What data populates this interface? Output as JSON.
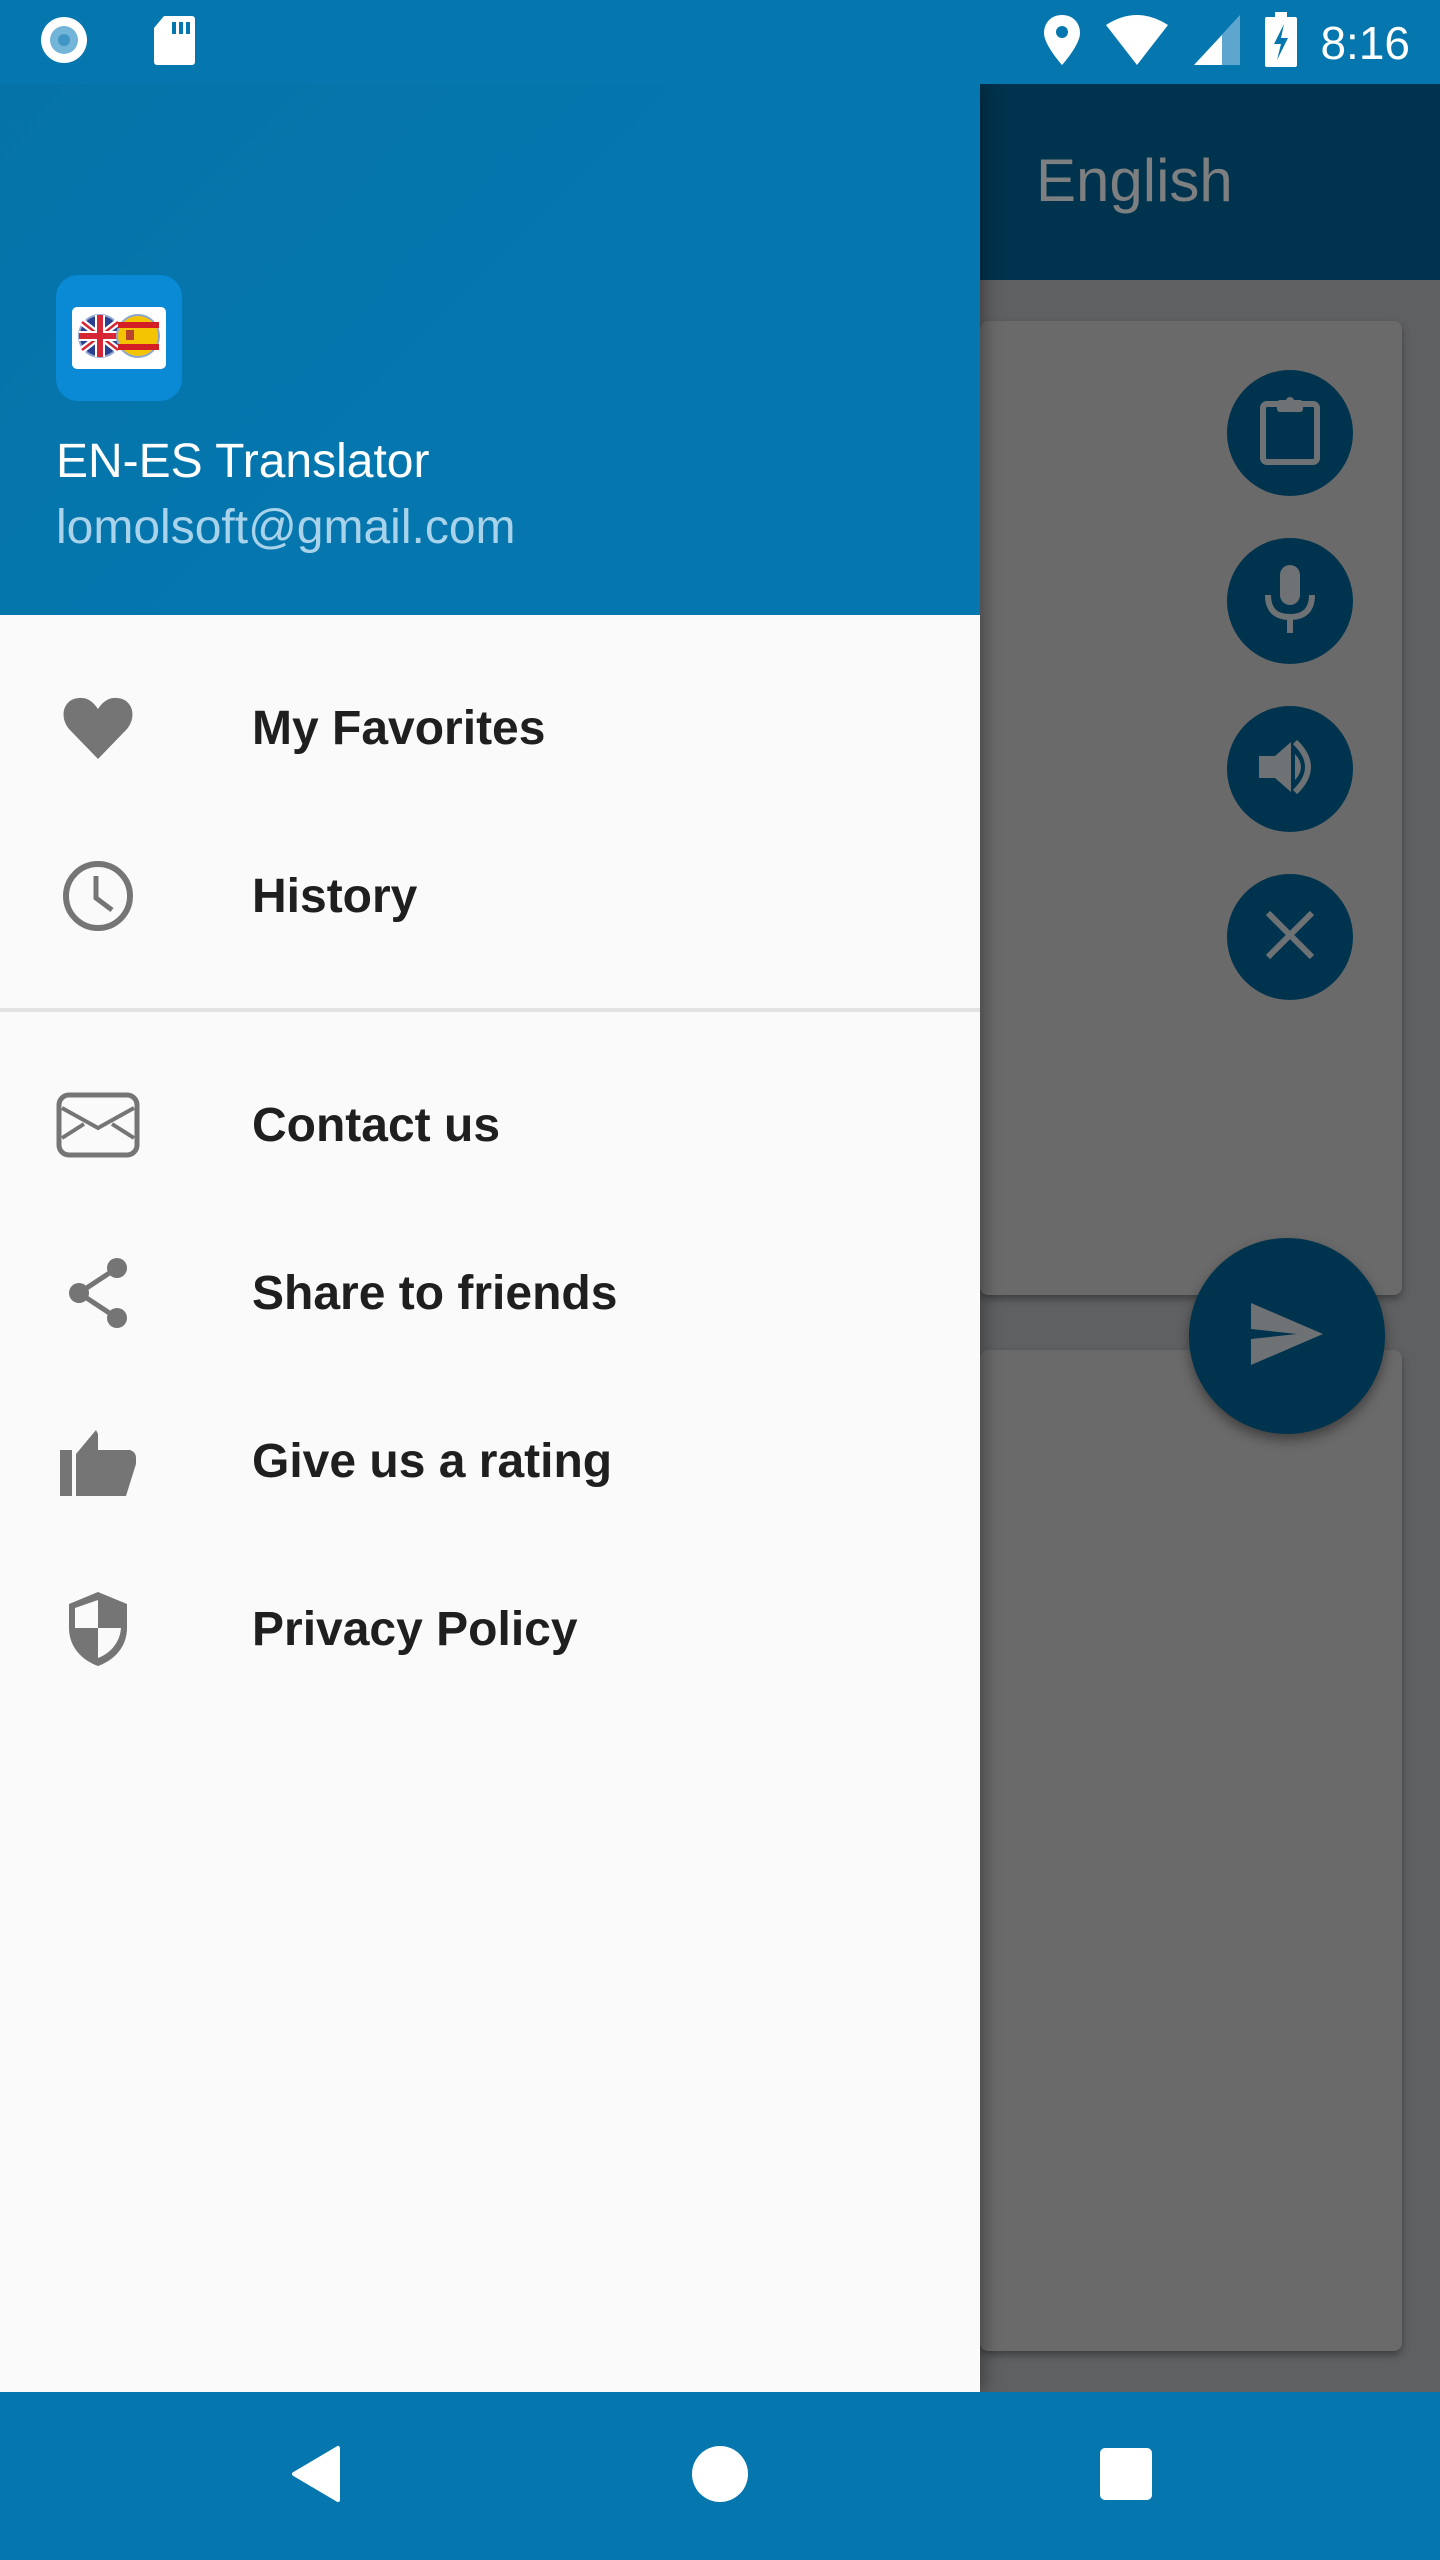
{
  "status_bar": {
    "time": "8:16",
    "left_icons": [
      "circle-notification-icon",
      "sd-card-icon"
    ],
    "right_icons": [
      "location-icon",
      "wifi-icon",
      "signal-icon",
      "battery-charging-icon"
    ]
  },
  "background_app": {
    "app_bar_title": "English",
    "action_buttons": [
      "clipboard-icon",
      "microphone-icon",
      "speaker-icon",
      "close-icon"
    ],
    "send_button_icon": "send-icon"
  },
  "drawer": {
    "header": {
      "app_name": "EN-ES Translator",
      "email": "lomolsoft@gmail.com",
      "logo": "uk-spain-flags-logo"
    },
    "primary_items": [
      {
        "label": "My Favorites",
        "icon": "heart-icon"
      },
      {
        "label": "History",
        "icon": "clock-icon"
      }
    ],
    "secondary_items": [
      {
        "label": "Contact us",
        "icon": "mail-icon"
      },
      {
        "label": "Share to friends",
        "icon": "share-icon"
      },
      {
        "label": "Give us a rating",
        "icon": "thumbs-up-icon"
      },
      {
        "label": "Privacy Policy",
        "icon": "shield-icon"
      }
    ]
  },
  "nav_bar": {
    "buttons": [
      "back-icon",
      "home-icon",
      "recents-icon"
    ]
  },
  "colors": {
    "primary": "#0577ae",
    "primary_dark_dimmed": "#00334d",
    "drawer_bg": "#fafafa",
    "icon_gray": "#757575",
    "text_dark": "#1f1f1f",
    "email_text": "#a8d3ea"
  }
}
